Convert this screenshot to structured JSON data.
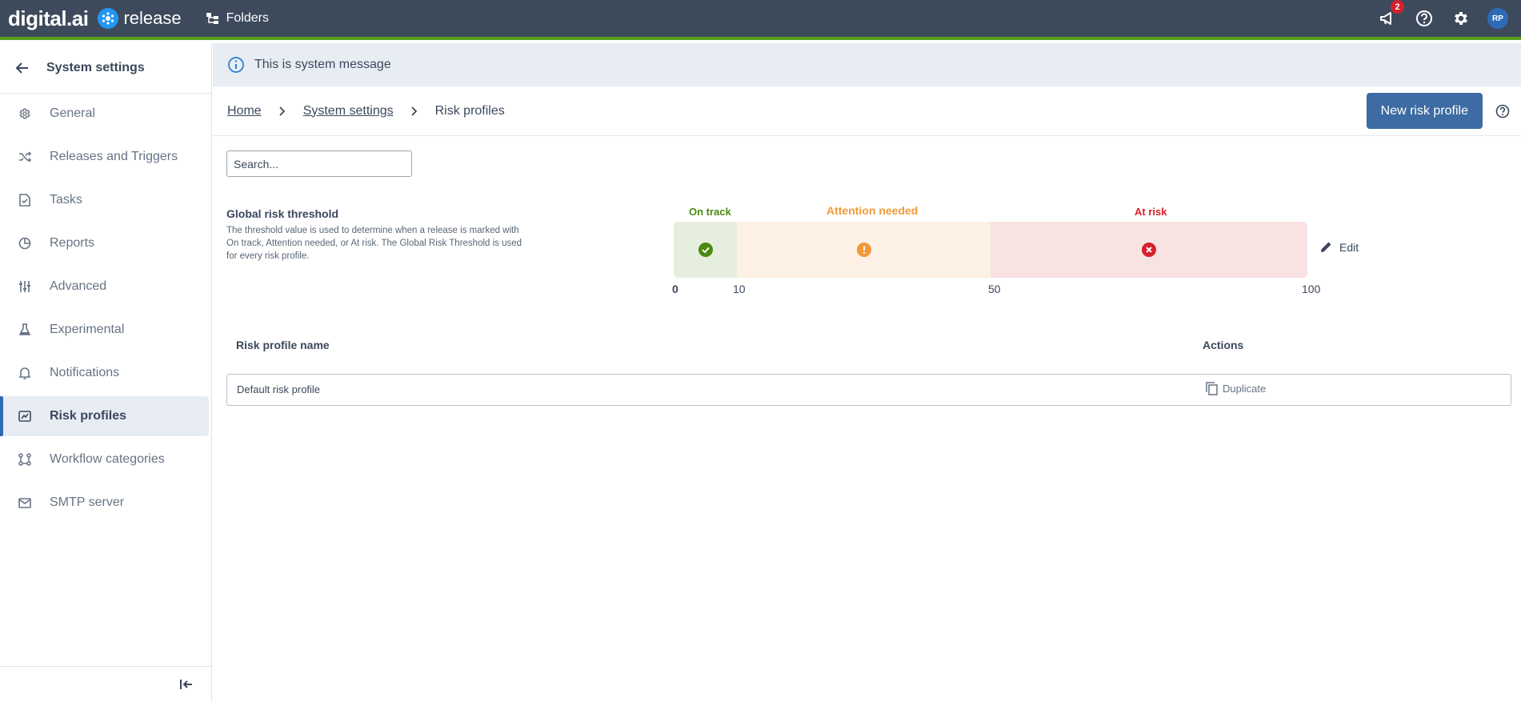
{
  "brand": {
    "digital": "digital.ai",
    "product": "release"
  },
  "topbar": {
    "folders_label": "Folders",
    "notifications_count": "2",
    "avatar_initials": "RP"
  },
  "sidebar": {
    "title": "System settings",
    "items": [
      {
        "label": "General",
        "icon": "gear-icon"
      },
      {
        "label": "Releases and Triggers",
        "icon": "shuffle-icon"
      },
      {
        "label": "Tasks",
        "icon": "task-icon"
      },
      {
        "label": "Reports",
        "icon": "pie-chart-icon"
      },
      {
        "label": "Advanced",
        "icon": "sliders-icon"
      },
      {
        "label": "Experimental",
        "icon": "flask-icon"
      },
      {
        "label": "Notifications",
        "icon": "bell-icon"
      },
      {
        "label": "Risk profiles",
        "icon": "risk-icon",
        "active": true
      },
      {
        "label": "Workflow categories",
        "icon": "workflow-icon"
      },
      {
        "label": "SMTP server",
        "icon": "mail-icon"
      }
    ]
  },
  "system_message": "This is system message",
  "breadcrumb": {
    "home": "Home",
    "settings": "System settings",
    "current": "Risk profiles"
  },
  "new_button_label": "New risk profile",
  "search": {
    "placeholder": "Search...",
    "value": ""
  },
  "threshold": {
    "title": "Global risk threshold",
    "description": "The threshold value is used to determine when a release is marked with On track, Attention needed, or At risk. The Global Risk Threshold is used for every risk profile.",
    "zones": {
      "on_track": {
        "label": "On track",
        "color": "#4a8a0f"
      },
      "attention": {
        "label": "Attention needed",
        "color": "#f09a3a"
      },
      "at_risk": {
        "label": "At risk",
        "color": "#d6202a"
      }
    },
    "ticks": [
      "0",
      "10",
      "50",
      "100"
    ],
    "edit_label": "Edit"
  },
  "table": {
    "col_name": "Risk profile name",
    "col_actions": "Actions",
    "rows": [
      {
        "name": "Default risk profile",
        "action": "Duplicate"
      }
    ]
  }
}
